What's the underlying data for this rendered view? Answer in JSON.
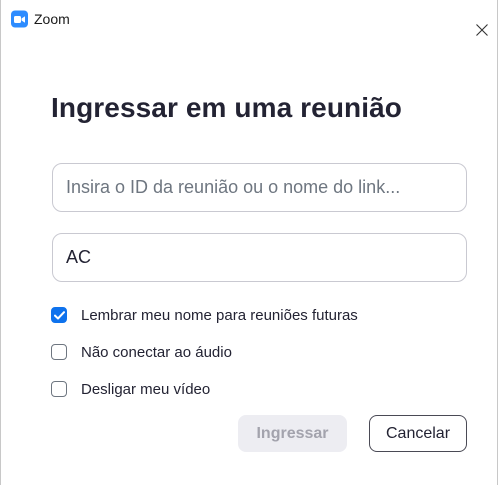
{
  "window": {
    "title": "Zoom",
    "icon": "zoom-camera-icon",
    "close_icon": "close-icon"
  },
  "dialog": {
    "heading": "Ingressar em uma reunião",
    "meeting_id": {
      "value": "",
      "placeholder": "Insira o ID da reunião ou o nome do link..."
    },
    "name": {
      "value": "AC",
      "placeholder": ""
    },
    "options": [
      {
        "label": "Lembrar meu nome para reuniões futuras",
        "checked": true
      },
      {
        "label": "Não conectar ao áudio",
        "checked": false
      },
      {
        "label": "Desligar meu vídeo",
        "checked": false
      }
    ],
    "buttons": {
      "join_label": "Ingressar",
      "join_enabled": false,
      "cancel_label": "Cancelar"
    }
  },
  "colors": {
    "accent": "#0e72ed",
    "app_icon": "#2d8cff",
    "disabled_button_bg": "#ededf2",
    "disabled_button_text": "#a3a3ad"
  }
}
